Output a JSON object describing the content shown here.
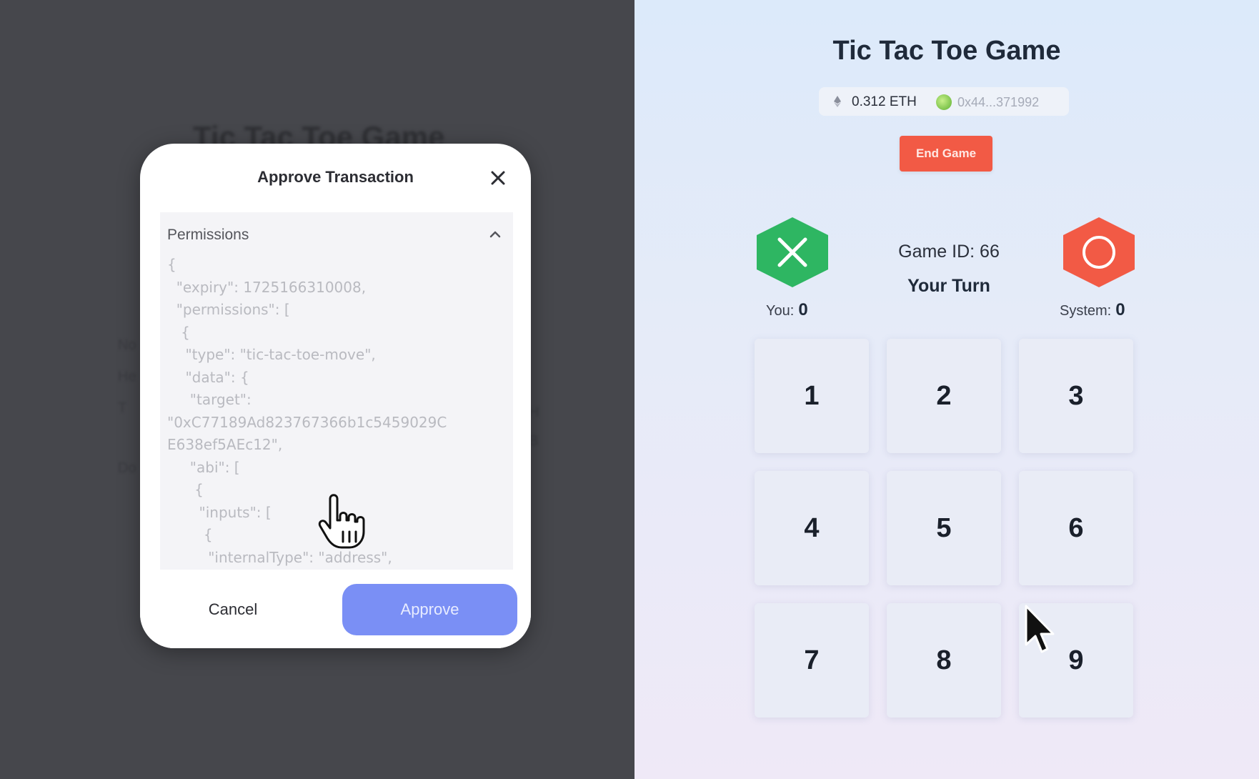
{
  "background": {
    "title": "Tic Tac Toe Game",
    "fragments": [
      "No",
      "He",
      "T",
      "Do",
      "H",
      "B"
    ]
  },
  "modal": {
    "title": "Approve Transaction",
    "close_icon": "close-icon",
    "permissions": {
      "label": "Permissions",
      "chevron_icon": "chevron-up-icon",
      "code": "{\n  \"expiry\": 1725166310008,\n  \"permissions\": [\n   {\n    \"type\": \"tic-tac-toe-move\",\n    \"data\": {\n     \"target\":\n\"0xC77189Ad823767366b1c5459029C\nE638ef5AEc12\",\n     \"abi\": [\n      {\n       \"inputs\": [\n        {\n         \"internalType\": \"address\",\n         \"name\": \"_gameId\","
    },
    "cancel_label": "Cancel",
    "approve_label": "Approve",
    "colors": {
      "approve_bg": "#7a8ff5"
    }
  },
  "game": {
    "title": "Tic Tac Toe Game",
    "wallet": {
      "eth_icon": "eth-icon",
      "balance": "0.312 ETH",
      "address": "0x44...371992"
    },
    "end_game_label": "End Game",
    "game_id": "Game ID: 66",
    "turn": "Your Turn",
    "players": {
      "you": {
        "label": "You:",
        "score": "0",
        "symbol": "x",
        "color": "#2eb662"
      },
      "system": {
        "label": "System:",
        "score": "0",
        "symbol": "o",
        "color": "#f25a45"
      }
    },
    "cells": [
      "1",
      "2",
      "3",
      "4",
      "5",
      "6",
      "7",
      "8",
      "9"
    ],
    "colors": {
      "end_game_bg": "#f25a45"
    }
  },
  "cursors": [
    "hand-pointer-cursor",
    "arrow-cursor"
  ]
}
